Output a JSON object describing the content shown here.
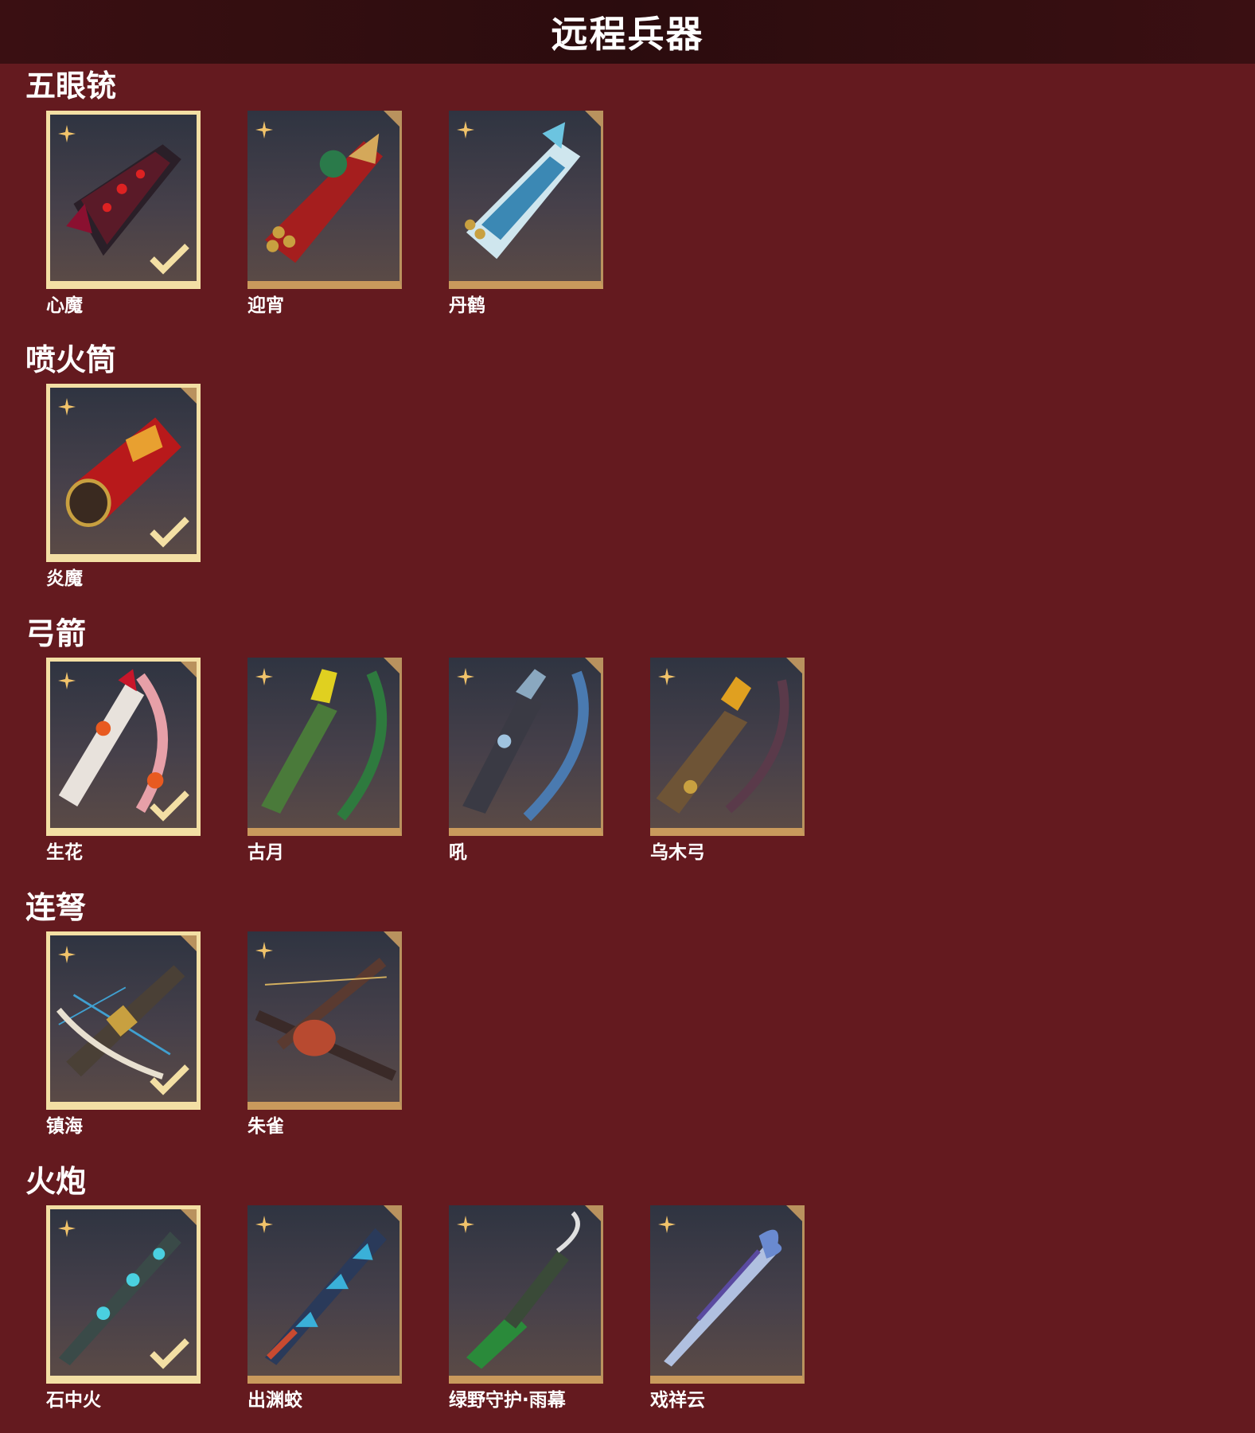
{
  "page": {
    "title": "远程兵器"
  },
  "colors": {
    "background": "#641a1f",
    "title_bar": "#2b0c0e",
    "card_border": "#c99a5c",
    "equipped_border": "#f3dfa4",
    "star": "#f1c36a"
  },
  "sections": [
    {
      "heading": "五眼铳",
      "items": [
        {
          "name": "心魔",
          "equipped": true,
          "icon": "dark-dragon-gun-icon"
        },
        {
          "name": "迎宵",
          "equipped": false,
          "icon": "red-lion-gun-icon"
        },
        {
          "name": "丹鹤",
          "equipped": false,
          "icon": "blue-crane-gun-icon"
        }
      ]
    },
    {
      "heading": "喷火筒",
      "items": [
        {
          "name": "炎魔",
          "equipped": true,
          "icon": "flame-tube-icon"
        }
      ]
    },
    {
      "heading": "弓箭",
      "items": [
        {
          "name": "生花",
          "equipped": true,
          "icon": "flower-bow-icon"
        },
        {
          "name": "古月",
          "equipped": false,
          "icon": "green-bow-icon"
        },
        {
          "name": "吼",
          "equipped": false,
          "icon": "cloud-bow-icon"
        },
        {
          "name": "乌木弓",
          "equipped": false,
          "icon": "wood-bow-icon"
        }
      ]
    },
    {
      "heading": "连弩",
      "items": [
        {
          "name": "镇海",
          "equipped": true,
          "icon": "sea-crossbow-icon"
        },
        {
          "name": "朱雀",
          "equipped": false,
          "icon": "phoenix-crossbow-icon"
        }
      ]
    },
    {
      "heading": "火炮",
      "items": [
        {
          "name": "石中火",
          "equipped": true,
          "icon": "stone-fire-cannon-icon"
        },
        {
          "name": "出渊蛟",
          "equipped": false,
          "icon": "dragon-cannon-icon"
        },
        {
          "name": "绿野守护·雨幕",
          "equipped": false,
          "icon": "green-guard-cannon-icon"
        },
        {
          "name": "戏祥云",
          "equipped": false,
          "icon": "cloud-cannon-icon"
        }
      ]
    }
  ]
}
